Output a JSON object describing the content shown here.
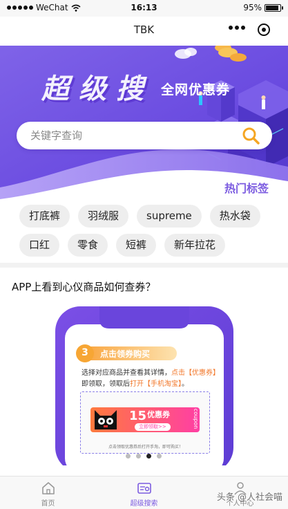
{
  "status_bar": {
    "carrier": "WeChat",
    "time": "16:13",
    "battery_text": "95%",
    "battery_level": 0.95
  },
  "nav": {
    "title": "TBK"
  },
  "banner": {
    "title": "超级搜",
    "subtitle": "全网优惠券",
    "colors": {
      "primary": "#7b5be0",
      "deep": "#5b3fd6",
      "light": "#a78bfa"
    }
  },
  "search": {
    "placeholder": "关键字查询"
  },
  "hot_tags": {
    "title": "热门标签",
    "items": [
      {
        "label": "打底裤"
      },
      {
        "label": "羽绒服"
      },
      {
        "label": "supreme"
      },
      {
        "label": "热水袋"
      },
      {
        "label": "口红"
      },
      {
        "label": "零食"
      },
      {
        "label": "短裤"
      },
      {
        "label": "新年拉花"
      }
    ]
  },
  "guide": {
    "question": "APP上看到心仪商品如何查券？",
    "step_number": "3",
    "step_title": "点击领券购买",
    "step_text_line1_a": "选择对应商品并查看其详情，",
    "step_text_line1_b": "点击【优惠券】",
    "step_text_line2_a": "即领取，领取后",
    "step_text_line2_b": "打开【手机淘宝】",
    "step_text_line2_c": "。",
    "coupon_badge": "15",
    "coupon_label": "优惠券",
    "coupon_button": "立即领取>>",
    "coupon_side": "coupon",
    "footer_note": "点击领取优惠券后打开手淘，即可购买！",
    "pager": {
      "count": 4,
      "active": 2
    }
  },
  "tabs": [
    {
      "label": "首页",
      "icon": "home-icon",
      "active": false
    },
    {
      "label": "超级搜索",
      "icon": "search-card-icon",
      "active": true
    },
    {
      "label": "个人中心",
      "icon": "user-icon",
      "active": false
    }
  ],
  "watermark": "头条 @人社会喵"
}
